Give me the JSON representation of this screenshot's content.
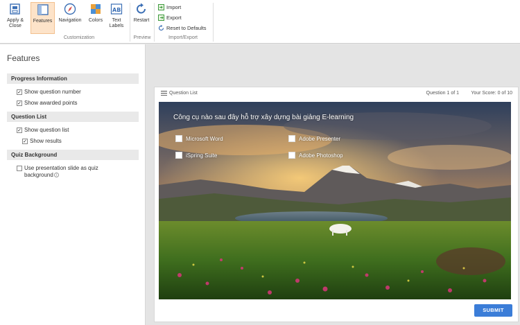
{
  "ribbon": {
    "buttons": [
      {
        "label": "Apply & Close",
        "icon": "apply-close-icon"
      },
      {
        "label": "Features",
        "icon": "features-icon",
        "active": true
      },
      {
        "label": "Navigation",
        "icon": "navigation-icon"
      },
      {
        "label": "Colors",
        "icon": "colors-icon"
      },
      {
        "label": "Text Labels",
        "icon": "text-labels-icon"
      },
      {
        "label": "Restart",
        "icon": "restart-icon"
      }
    ],
    "groups": {
      "customization": "Customization",
      "preview": "Preview",
      "import_export": "Import/Export"
    },
    "import_export": {
      "import": "Import",
      "export": "Export",
      "reset": "Reset to Defaults"
    }
  },
  "panel": {
    "title": "Features",
    "sections": {
      "progress": {
        "title": "Progress Information",
        "options": [
          {
            "label": "Show question number",
            "checked": true
          },
          {
            "label": "Show awarded points",
            "checked": true
          }
        ]
      },
      "question_list": {
        "title": "Question List",
        "options": [
          {
            "label": "Show question list",
            "checked": true
          },
          {
            "label": "Show results",
            "checked": true
          }
        ]
      },
      "background": {
        "title": "Quiz Background",
        "option_line1": "Use presentation slide as quiz",
        "option_line2": "background",
        "checked": false
      }
    }
  },
  "preview": {
    "question_list_label": "Question List",
    "question_counter": "Question 1 of 1",
    "score": "Your Score: 0 of 10",
    "question": "Công cụ nào sau đây hỗ trợ xây dựng bài giảng E-learning",
    "answers": [
      "Microsoft Word",
      "Adobe Presenter",
      "iSpring Suite",
      "Adobe Photoshop"
    ],
    "submit": "SUBMIT"
  },
  "colors": {
    "accent": "#3b7dd8",
    "active_tab": "#fde3c9"
  }
}
